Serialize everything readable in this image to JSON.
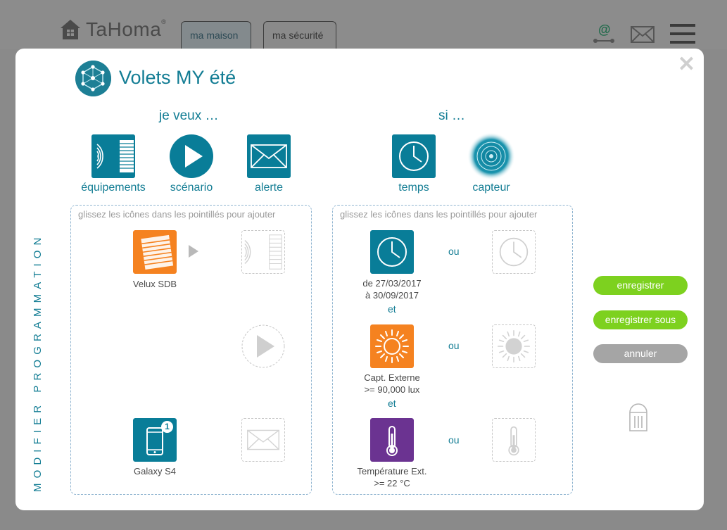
{
  "app": {
    "logo_text": "TaHoma",
    "logo_mark": "®"
  },
  "header": {
    "tabs": [
      {
        "label": "ma maison"
      },
      {
        "label": "ma sécurité"
      }
    ],
    "icons": [
      "email-at-icon",
      "envelope-icon",
      "hamburger-menu-icon"
    ]
  },
  "modal": {
    "title": "Volets MY été",
    "vertical_label": "MODIFIER PROGRAMMATION",
    "actions_section": {
      "title": "je veux …",
      "tools": [
        {
          "label": "équipements",
          "icon": "equipment-icon"
        },
        {
          "label": "scénario",
          "icon": "play-icon"
        },
        {
          "label": "alerte",
          "icon": "envelope-icon"
        }
      ],
      "hint": "glissez les icônes dans les pointillés pour ajouter",
      "items": [
        {
          "label": "Velux SDB",
          "icon": "blind-icon"
        },
        {
          "label": "Galaxy S4",
          "icon": "smartphone-icon",
          "badge": "1"
        }
      ]
    },
    "conditions_section": {
      "title": "si …",
      "tools": [
        {
          "label": "temps",
          "icon": "clock-icon"
        },
        {
          "label": "capteur",
          "icon": "sensor-icon"
        }
      ],
      "hint": "glissez les icônes dans les pointillés pour ajouter",
      "conditions": [
        {
          "line1": "de 27/03/2017",
          "line2": "à 30/09/2017",
          "icon": "clock-icon"
        },
        {
          "line1": "Capt. Externe",
          "line2": ">= 90,000 lux",
          "icon": "sun-icon"
        },
        {
          "line1": "Température Ext.",
          "line2": ">= 22 °C",
          "icon": "thermometer-icon"
        }
      ],
      "or_label": "ou",
      "and_label": "et"
    },
    "buttons": {
      "save": "enregistrer",
      "save_as": "enregistrer sous",
      "cancel": "annuler"
    }
  },
  "colors": {
    "teal": "#097d98",
    "orange": "#f58220",
    "purple": "#6b3391",
    "green": "#7dd11f",
    "gray": "#a5a5a5"
  }
}
